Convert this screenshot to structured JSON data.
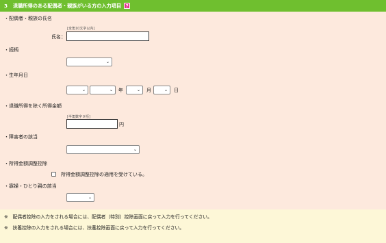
{
  "header": {
    "number": "3",
    "title": "退職所得のある配偶者・親族がいる方の入力項目",
    "help_icon": "?"
  },
  "spouse_name": {
    "section_label": "・配偶者・親族の氏名",
    "hint": "[全角10文字以内]",
    "field_label": "氏名：",
    "value": ""
  },
  "relationship": {
    "section_label": "・続柄",
    "selected": ""
  },
  "birth_date": {
    "section_label": "・生年月日",
    "era_selected": "",
    "year_selected": "",
    "year_unit": "年",
    "month_selected": "",
    "month_unit": "月",
    "day_selected": "",
    "day_unit": "日"
  },
  "income": {
    "section_label": "・退職所得を除く所得金額",
    "hint": "[半角数字９桁]",
    "value": "",
    "unit": "円"
  },
  "disability": {
    "section_label": "・障害者の該当",
    "selected": ""
  },
  "income_adjustment": {
    "section_label": "・所得金額調整控除",
    "checkbox_label": "所得金額調整控除の適用を受けている。",
    "checked": false
  },
  "widow": {
    "section_label": "・寡婦・ひとり親の該当",
    "selected": ""
  },
  "notes": [
    "※　配偶者控除の入力をされる場合には、配偶者（特別）控除画面に戻って入力を行ってください。",
    "※　扶養控除の入力をされる場合には、扶養控除画面に戻って入力を行ってください。"
  ],
  "colors": {
    "header_bg": "#6fbf2f",
    "panel_bg": "#fde9dd",
    "notes_bg": "#fdf7d7",
    "help_icon_bg": "#e0338a"
  }
}
